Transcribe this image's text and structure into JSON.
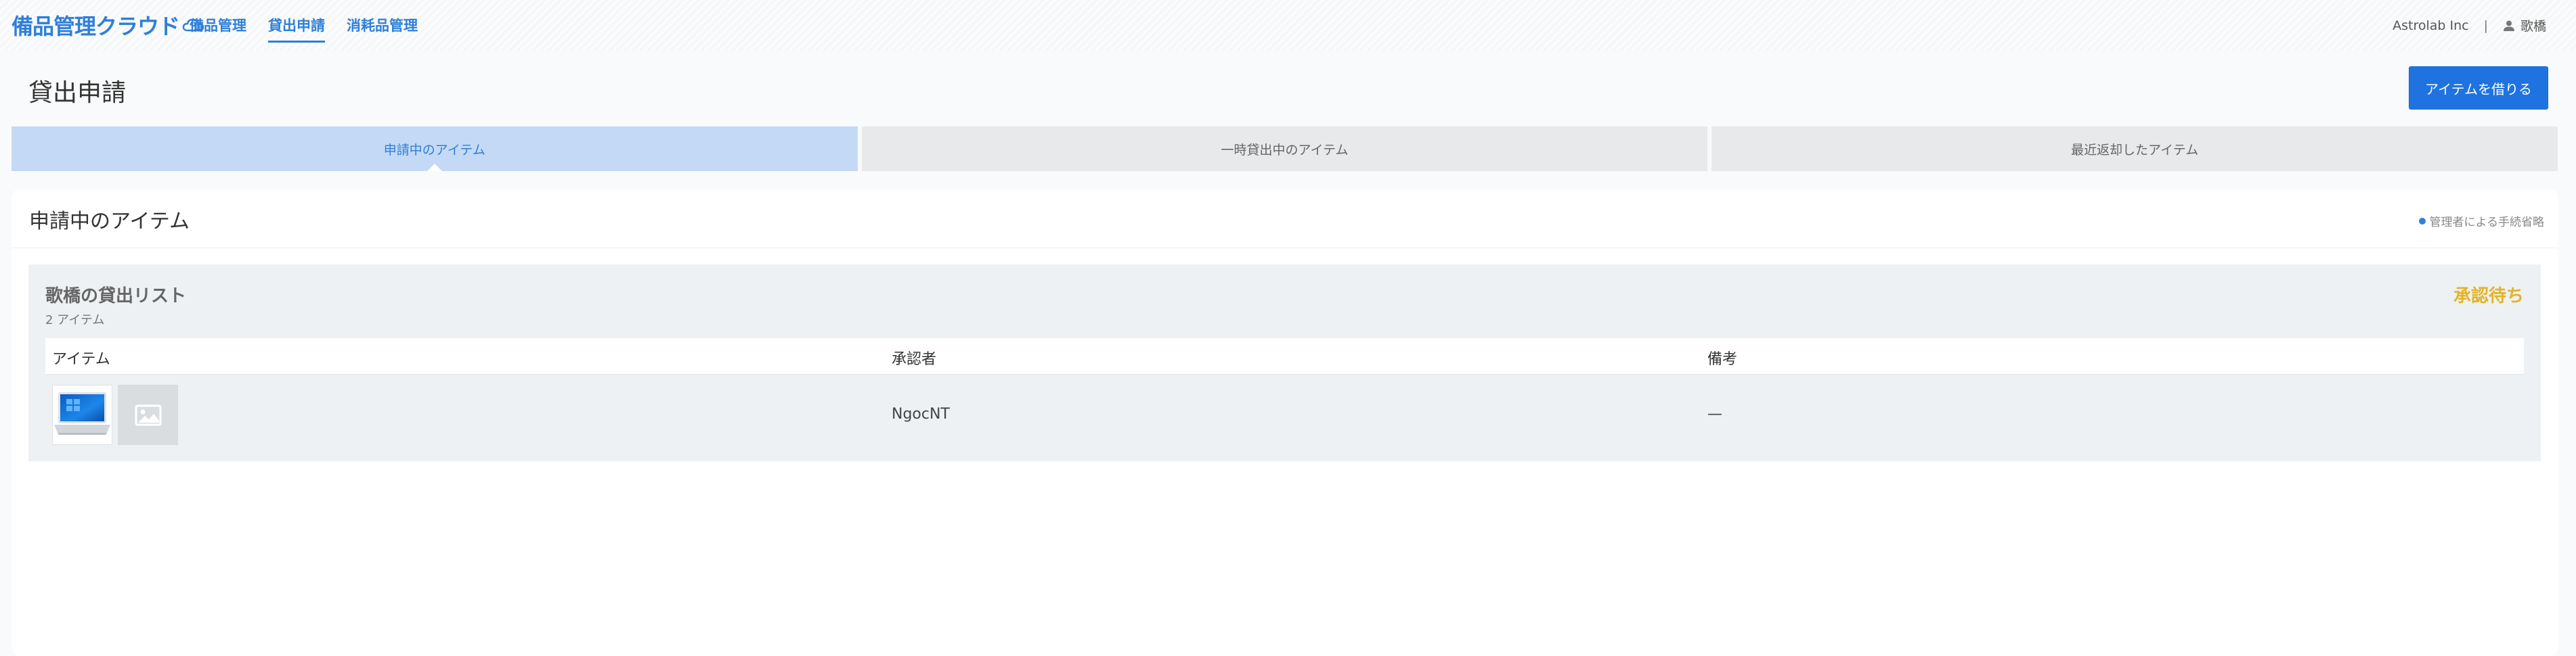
{
  "header": {
    "logo_text": "備品管理クラウド",
    "nav": [
      {
        "label": "備品管理",
        "active": false
      },
      {
        "label": "貸出申請",
        "active": true
      },
      {
        "label": "消耗品管理",
        "active": false
      }
    ],
    "company": "Astrolab Inc",
    "separator": "|",
    "user_name": "歌橋"
  },
  "page": {
    "title": "貸出申請",
    "primary_button": "アイテムを借りる"
  },
  "tabs": [
    {
      "label": "申請中のアイテム",
      "active": true
    },
    {
      "label": "一時貸出中のアイテム",
      "active": false
    },
    {
      "label": "最近返却したアイテム",
      "active": false
    }
  ],
  "card": {
    "title": "申請中のアイテム",
    "legend": "管理者による手続省略"
  },
  "lending_list": {
    "title": "歌橋の貸出リスト",
    "count": "2 アイテム",
    "status": "承認待ち",
    "columns": [
      "アイテム",
      "承認者",
      "備考"
    ],
    "rows": [
      {
        "approver": "NgocNT",
        "note": "—"
      }
    ]
  },
  "colors": {
    "brand": "#2f7fd8",
    "primary_button": "#1f73e0",
    "status_pending": "#e5b327",
    "active_tab_bg": "#c4d9f6"
  },
  "icons": {
    "user": "user-icon",
    "image_placeholder": "image-placeholder-icon",
    "cloud": "cloud-icon"
  }
}
